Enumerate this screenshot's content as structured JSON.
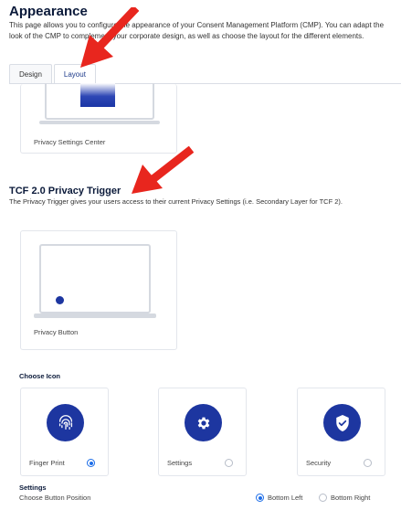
{
  "header": {
    "title": "Appearance",
    "description": "This page allows you to configure the appearance of your Consent Management Platform (CMP). You can adapt the look of the CMP to complement your corporate design, as well as choose the layout for the different elements."
  },
  "tabs": [
    {
      "label": "Design",
      "active": false
    },
    {
      "label": "Layout",
      "active": true
    }
  ],
  "privacy_settings_center": {
    "label": "Privacy Settings Center"
  },
  "privacy_trigger": {
    "title": "TCF 2.0 Privacy Trigger",
    "description": "The Privacy Trigger gives your users access to their current Privacy Settings (i.e. Secondary Layer for TCF 2).",
    "button_label": "Privacy Button"
  },
  "choose_icon": {
    "title": "Choose Icon",
    "options": [
      {
        "label": "Finger Print",
        "icon": "fingerprint-icon",
        "selected": true
      },
      {
        "label": "Settings",
        "icon": "gear-icon",
        "selected": false
      },
      {
        "label": "Security",
        "icon": "shield-check-icon",
        "selected": false
      }
    ]
  },
  "settings": {
    "title": "Settings",
    "position_label": "Choose Button Position",
    "positions": [
      {
        "label": "Bottom Left",
        "selected": true
      },
      {
        "label": "Bottom Right",
        "selected": false
      }
    ]
  },
  "colors": {
    "accent": "#1d36a0",
    "radio_active": "#1e6ee8",
    "annotation_arrow": "#e8261e"
  }
}
